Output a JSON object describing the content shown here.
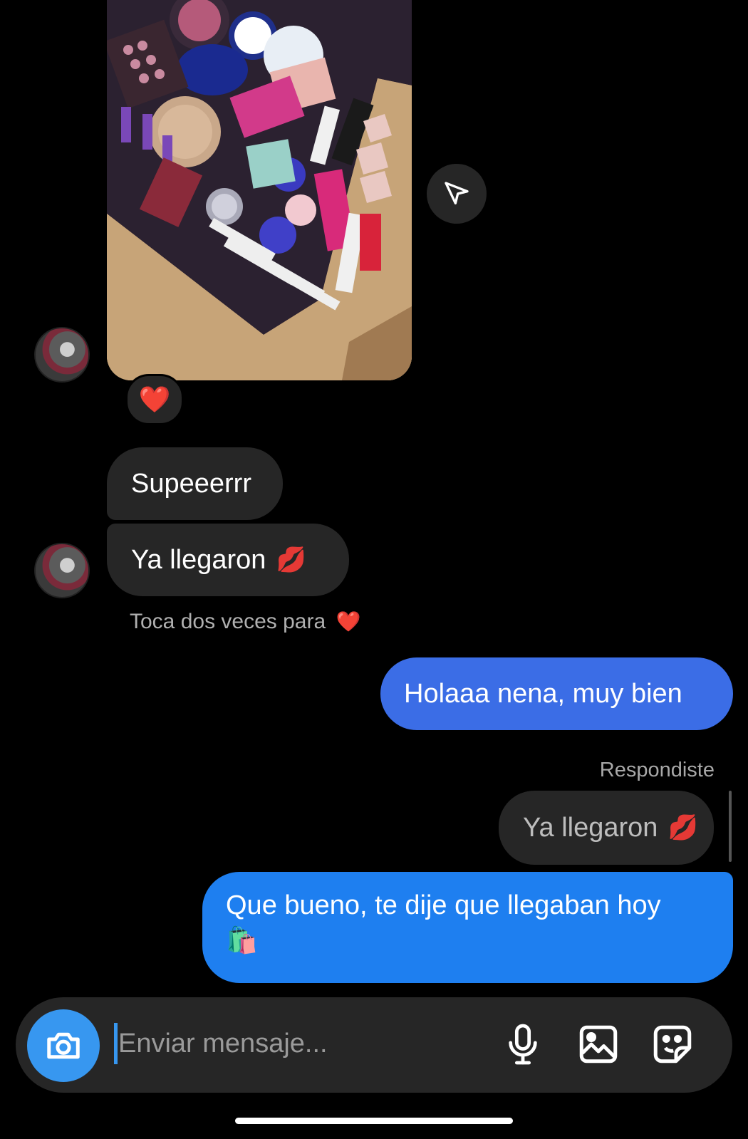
{
  "thread": {
    "incoming": {
      "image_alt": "photo-of-makeup-box",
      "reaction": "❤️",
      "messages": [
        "Supeeerrr",
        "Ya llegaron"
      ],
      "lips_emoji": "💋",
      "double_tap_hint": "Toca dos veces para",
      "hint_heart": "❤️"
    },
    "outgoing": {
      "message_1": "Holaaa nena, muy bien",
      "reply_label": "Respondiste",
      "quoted_text": "Ya llegaron",
      "quoted_emoji": "💋",
      "message_2": "Que bueno, te dije que llegaban hoy",
      "message_2_emoji": "🛍️"
    }
  },
  "composer": {
    "placeholder": "Enviar mensaje...",
    "icons": [
      "camera-icon",
      "microphone-icon",
      "gallery-icon",
      "sticker-icon"
    ]
  },
  "colors": {
    "outgoing_bubble_1": "#3b6de6",
    "outgoing_bubble_2": "#1e7ff0",
    "incoming_bubble": "#262626",
    "accent": "#3797f0"
  }
}
